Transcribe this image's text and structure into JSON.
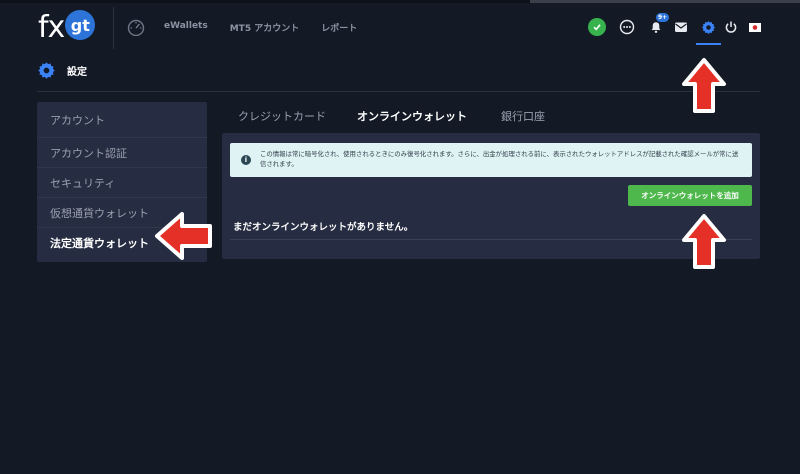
{
  "header": {
    "logo": {
      "fx": "fx",
      "gt": "gt"
    },
    "nav": [
      "eWallets",
      "MT5 アカウント",
      "レポート"
    ],
    "icons": [
      "dashboard-icon",
      "check-icon",
      "chat-icon",
      "bell-icon",
      "mail-icon",
      "gear-icon",
      "power-icon",
      "japan-flag-icon"
    ],
    "notification_badge": "9+"
  },
  "page": {
    "title": "設定"
  },
  "sidebar": {
    "items": [
      {
        "label": "アカウント"
      },
      {
        "label": "アカウント認証"
      },
      {
        "label": "セキュリティ"
      },
      {
        "label": "仮想通貨ウォレット"
      },
      {
        "label": "法定通貨ウォレット"
      }
    ],
    "active_index": 4
  },
  "tabs": [
    {
      "label": "クレジットカード"
    },
    {
      "label": "オンラインウォレット"
    },
    {
      "label": "銀行口座"
    }
  ],
  "main": {
    "info_text": "この情報は常に暗号化され、使用されるときにのみ復号化されます。さらに、出金が処理される前に、表示されたウォレットアドレスが記載された確認メールが常に送信されます。",
    "add_button_label": "オンラインウォレットを追加",
    "empty_message": "まだオンラインウォレットがありません。"
  },
  "colors": {
    "background": "#131a26",
    "panel": "#262c41",
    "accent": "#3b82f6",
    "success": "#4fb84d",
    "info_bg": "#dff2f4",
    "annotation_arrow": "#e53027"
  }
}
